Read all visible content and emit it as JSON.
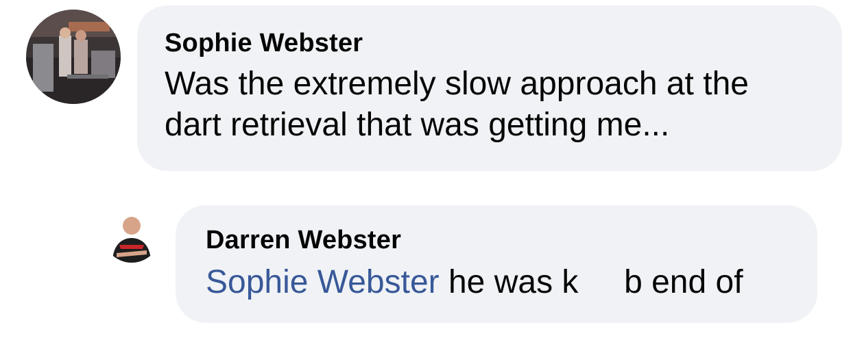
{
  "comments": [
    {
      "author": "Sophie Webster",
      "text_lines": [
        "Was the extremely slow approach at the",
        "dart retrieval that was getting me..."
      ],
      "avatar_icon": "profile-photo"
    },
    {
      "author": "Darren Webster",
      "mention": "Sophie Webster",
      "text": " he was k     b end of",
      "avatar_icon": "profile-photo"
    }
  ],
  "colors": {
    "bubble_bg": "#f0f2f5",
    "text": "#050505",
    "mention": "#385898"
  }
}
